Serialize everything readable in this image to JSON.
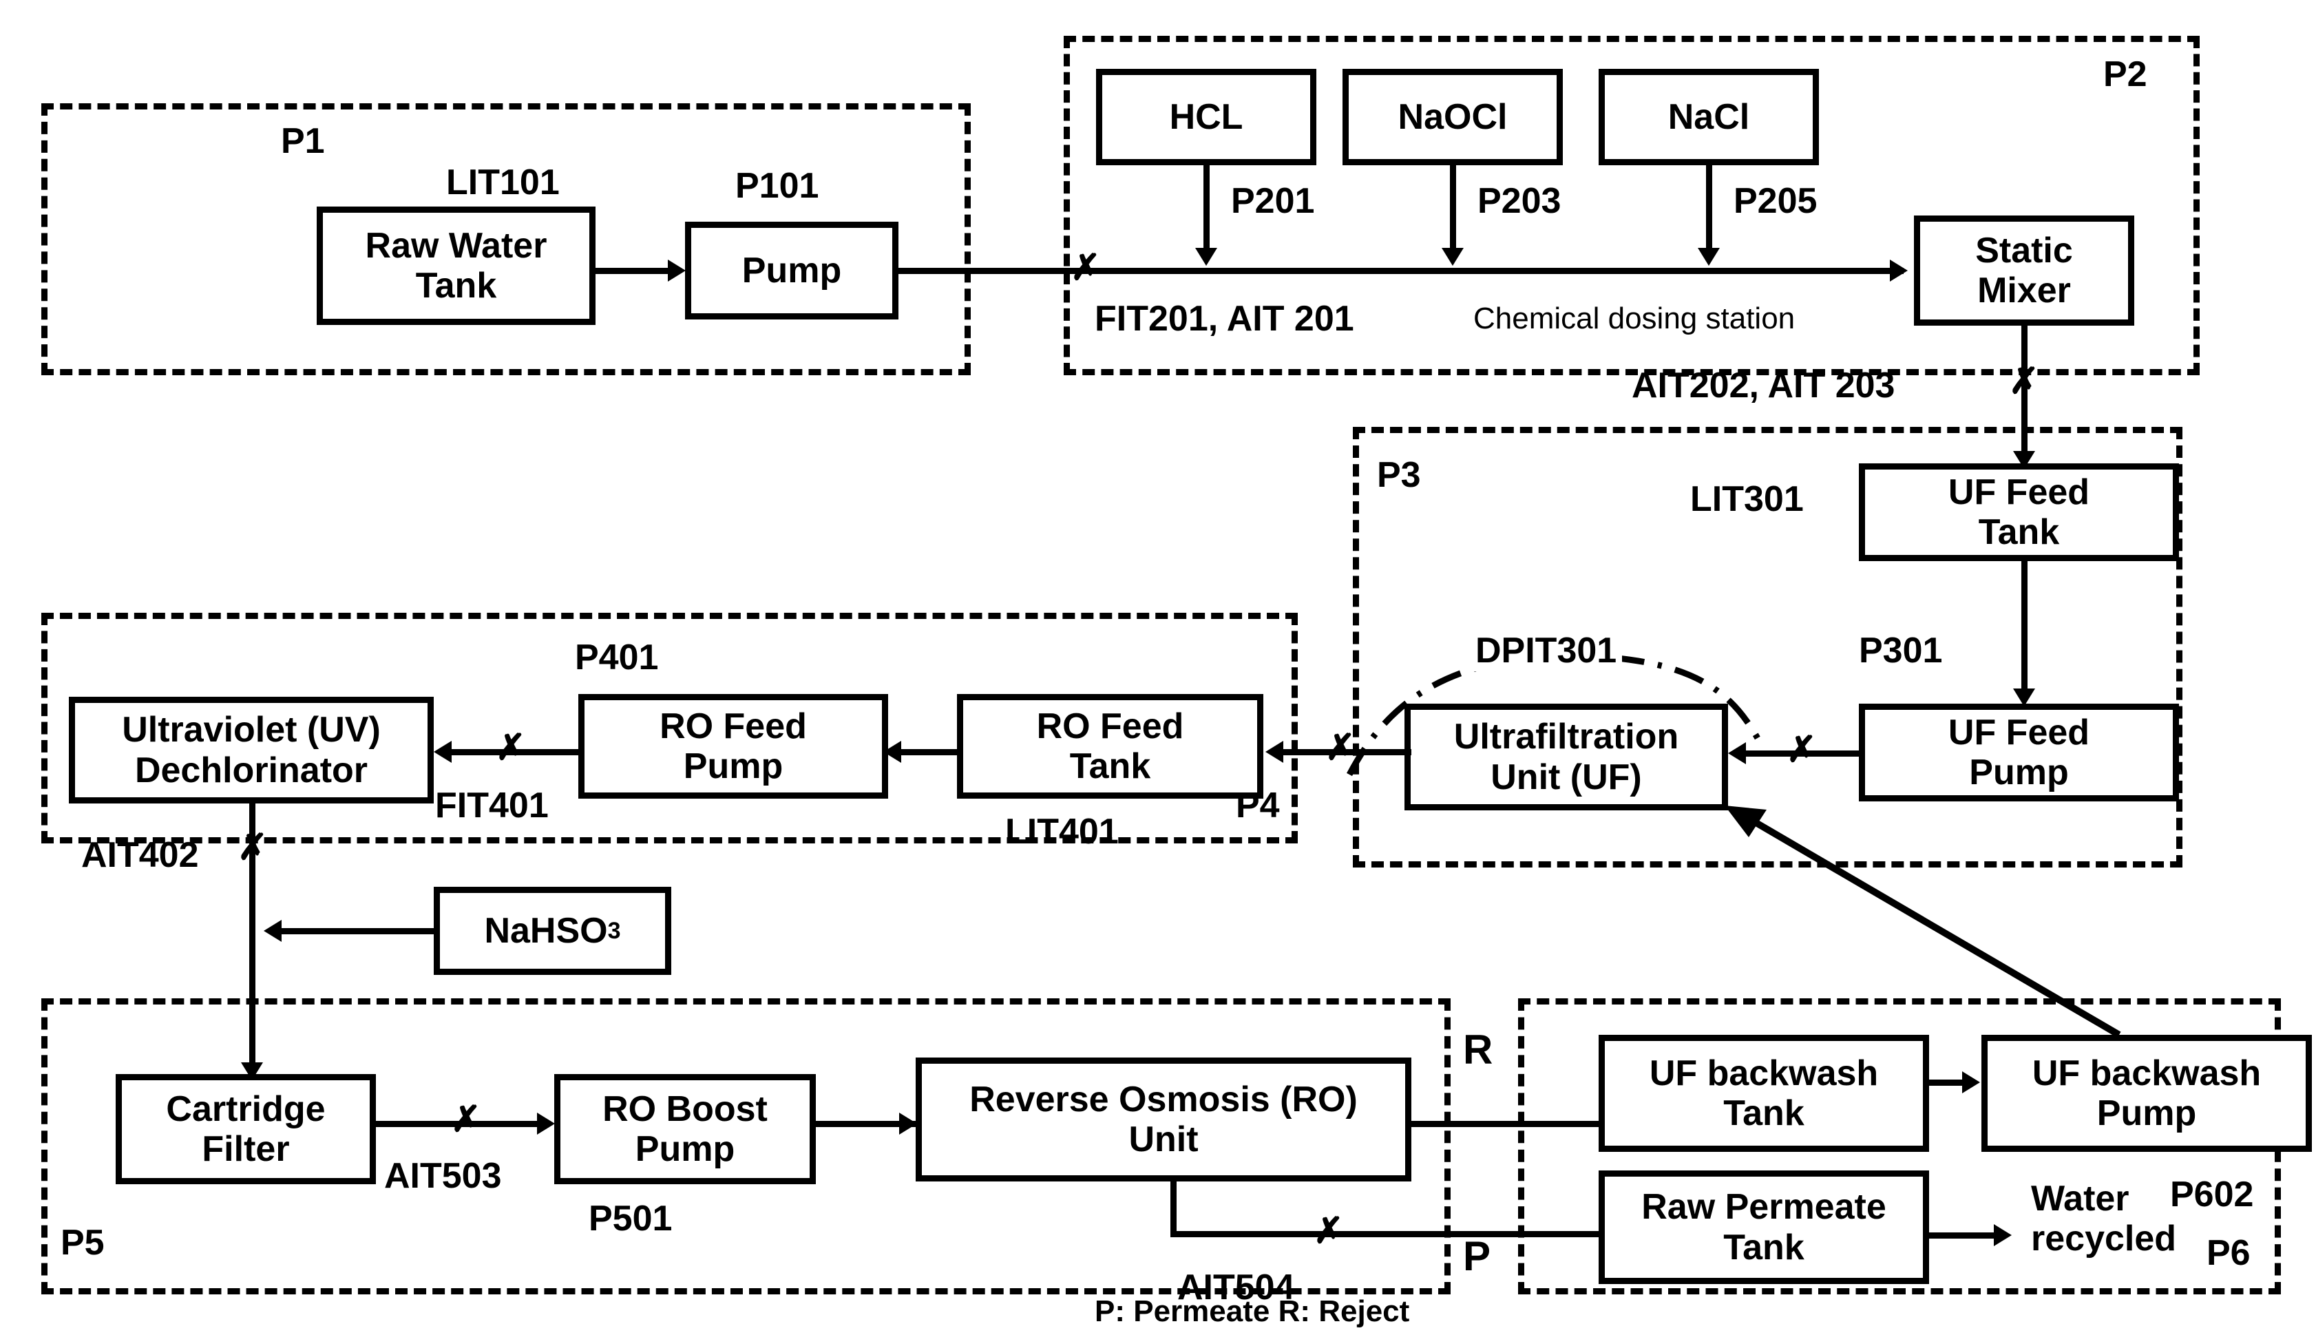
{
  "diagram": {
    "title": "SWaT water treatment process flow diagram",
    "legend": "P: Permeate R: Reject"
  },
  "zones": [
    {
      "id": "P1",
      "label": "P1"
    },
    {
      "id": "P2",
      "label": "P2"
    },
    {
      "id": "P3",
      "label": "P3"
    },
    {
      "id": "P4",
      "label": "P4"
    },
    {
      "id": "P5",
      "label": "P5"
    },
    {
      "id": "P6",
      "label": "P6"
    }
  ],
  "units": {
    "raw_water_tank": "Raw Water\nTank",
    "pump": "Pump",
    "hcl": "HCL",
    "naocl": "NaOCl",
    "nacl": "NaCl",
    "static_mixer": "Static\nMixer",
    "uf_feed_tank": "UF Feed\nTank",
    "uf_feed_pump": "UF Feed\nPump",
    "ultrafiltration_unit": "Ultrafiltration\nUnit (UF)",
    "ro_feed_tank": "RO Feed\nTank",
    "ro_feed_pump": "RO Feed\nPump",
    "uv_dechlorinator": "Ultraviolet (UV)\nDechlorinator",
    "nahso3": "NaHSO",
    "nahso3_sub": "3",
    "cartridge_filter": "Cartridge\nFilter",
    "ro_boost_pump": "RO Boost\nPump",
    "ro_unit": "Reverse Osmosis (RO)\nUnit",
    "uf_backwash_tank": "UF backwash\nTank",
    "uf_backwash_pump": "UF backwash\nPump",
    "raw_permeate_tank": "Raw Permeate\nTank"
  },
  "tags": {
    "lit101": "LIT101",
    "p101": "P101",
    "p201": "P201",
    "p203": "P203",
    "p205": "P205",
    "fit201_ait201": "FIT201, AIT 201",
    "chemical_dosing_station": "Chemical dosing station",
    "ait202_ait203": "AIT202, AIT 203",
    "lit301": "LIT301",
    "p301": "P301",
    "dpit301": "DPIT301",
    "p401": "P401",
    "fit401": "FIT401",
    "lit401": "LIT401",
    "ait402": "AIT402",
    "ait503": "AIT503",
    "p501": "P501",
    "ait504": "AIT504",
    "p602": "P602",
    "reject": "R",
    "permeate": "P",
    "water_recycled": "Water\nrecycled",
    "legend_note": "P: Permeate R: Reject",
    "valve_mark": "✗"
  },
  "colors": {
    "line": "#000000",
    "background": "#ffffff"
  }
}
